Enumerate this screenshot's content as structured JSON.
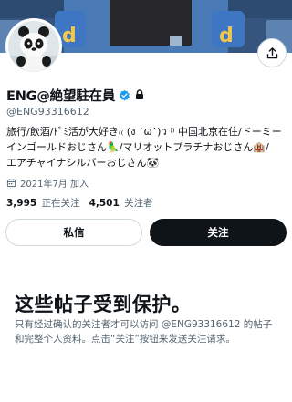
{
  "profile": {
    "display_name": "ENG@絶望駐在員",
    "handle": "@ENG93316612",
    "bio_lines": [
      "旅行/飲酒/ﾄﾞﾐ活が大好き₍₍ (ง ˙ω˙)ว ⁾⁾ 中国北京在住/ドーミー",
      "インゴールドおじさん🦜/マリオットプラチナおじさん🏨/",
      "エアチャイナシルバーおじさん🐼"
    ],
    "joined": "2021年7月 加入",
    "following_count": "3,995",
    "following_label": "正在关注",
    "followers_count": "4,501",
    "followers_label": "关注者"
  },
  "actions": {
    "message_label": "私信",
    "follow_label": "关注"
  },
  "protected": {
    "title": "这些帖子受到保护。",
    "description_lines": [
      "只有经过确认的关注者才可以访问 @ENG93316612 的帖子",
      "和完整个人资料。点击“关注”按钮来发送关注请求。"
    ]
  },
  "colors": {
    "accent": "#1d9bf0",
    "text_primary": "#0f1419",
    "text_secondary": "#536471",
    "border": "#cfd9de",
    "follow_button_bg": "#0f1419",
    "banner": "#3b5f8f"
  },
  "icons": {
    "share": "share-icon",
    "verified": "verified-badge-icon",
    "protected": "lock-icon",
    "joined": "calendar-icon"
  }
}
